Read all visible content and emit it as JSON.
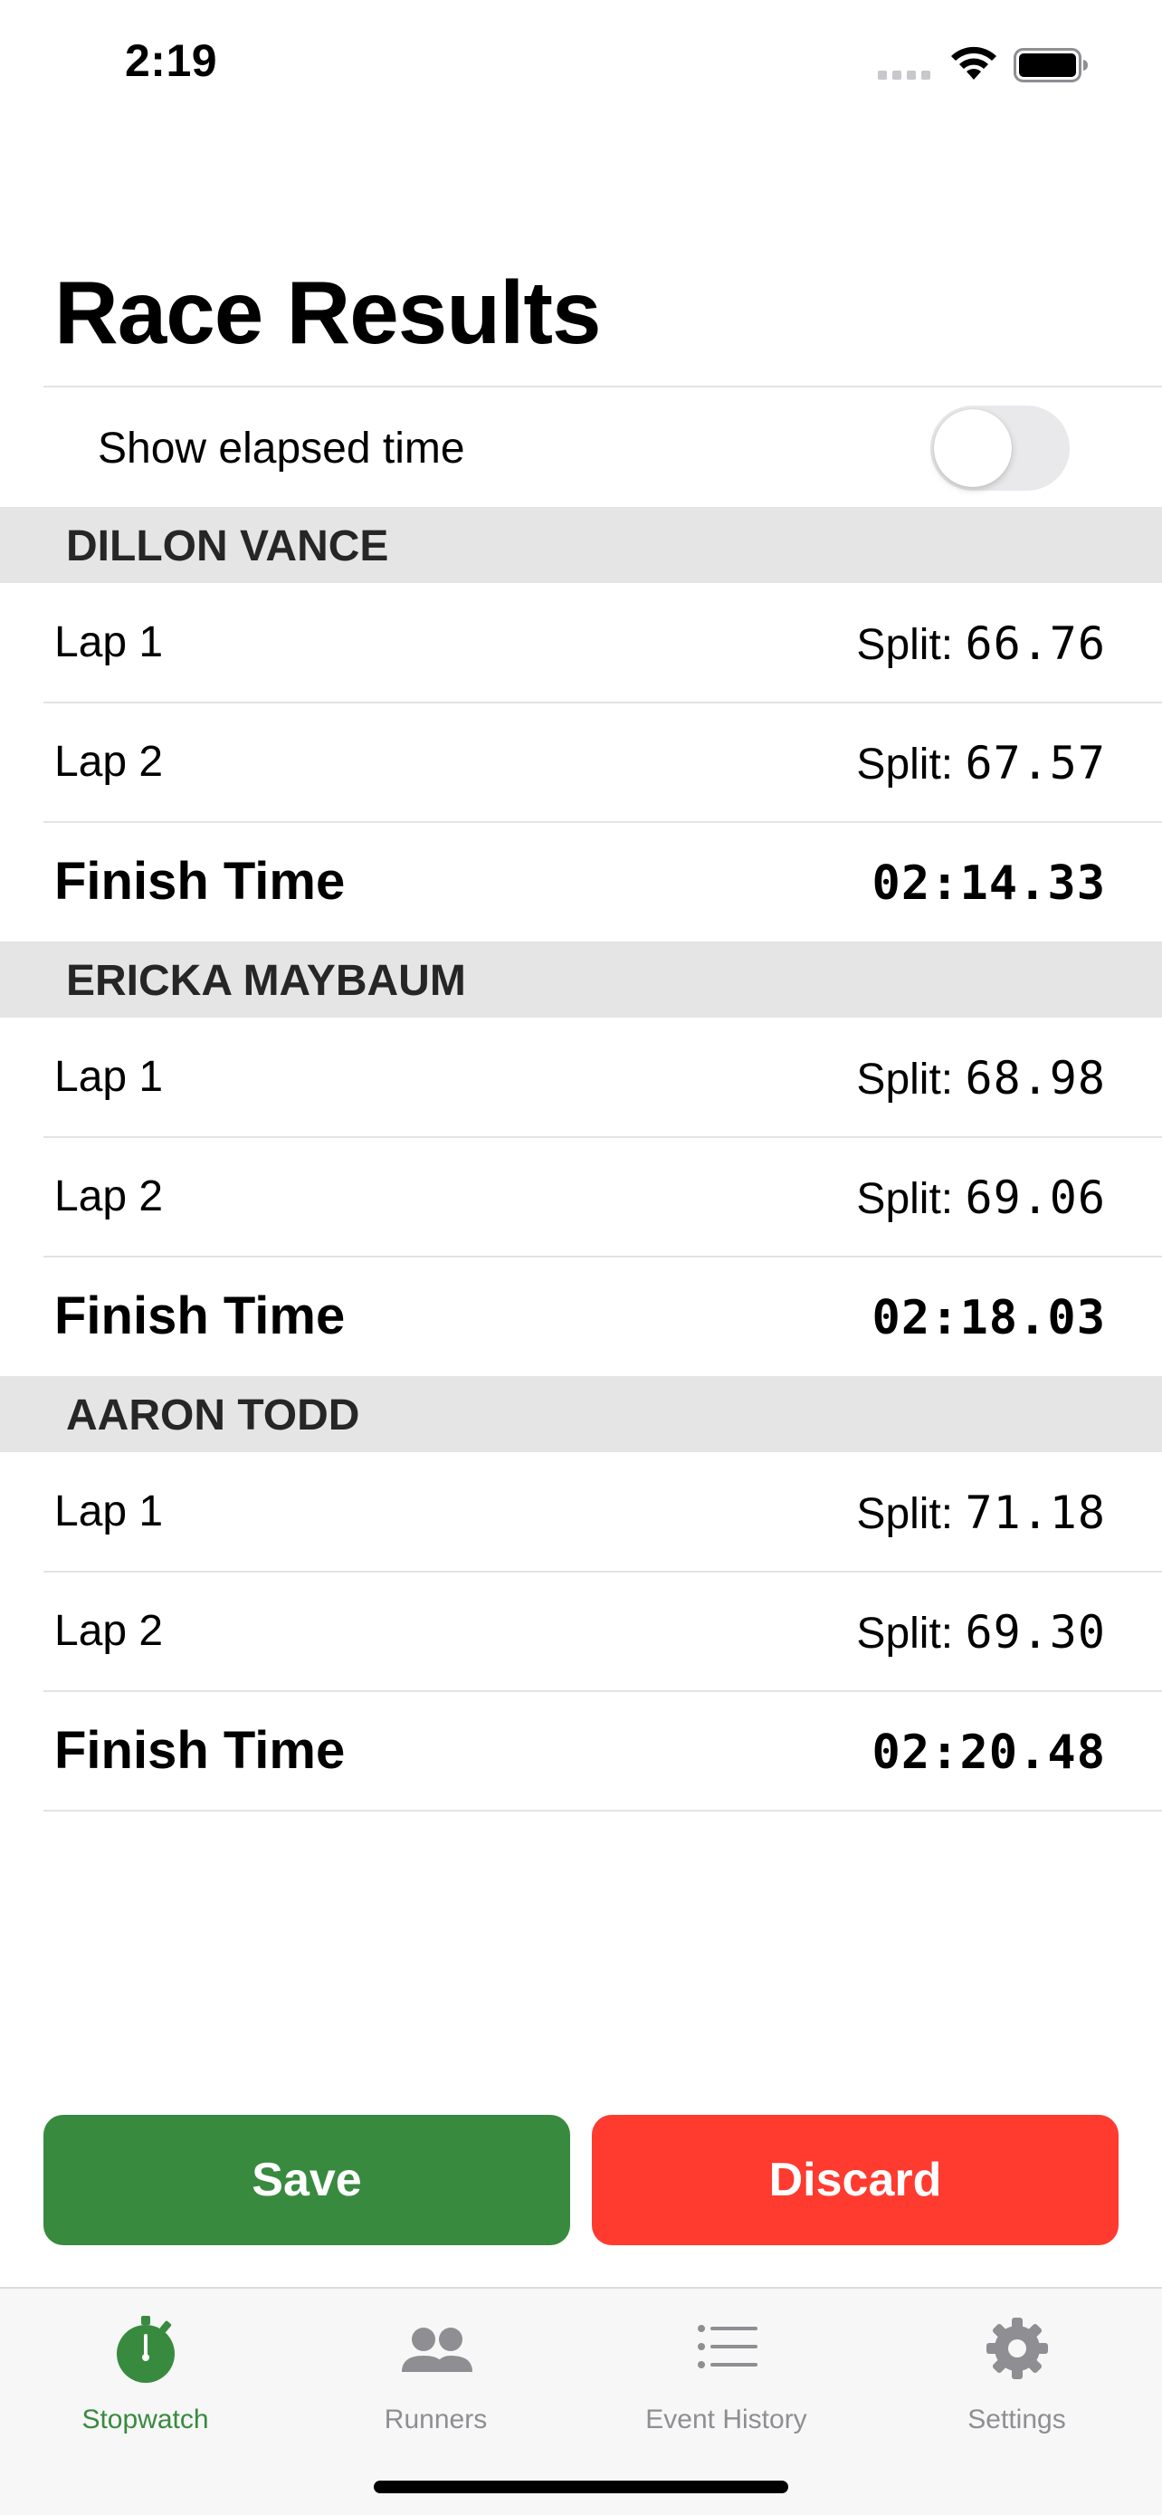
{
  "status_bar": {
    "time": "2:19"
  },
  "title": "Race Results",
  "toggle": {
    "label": "Show elapsed time",
    "on": false
  },
  "runners": [
    {
      "name": "DILLON VANCE",
      "laps": [
        {
          "label": "Lap 1",
          "split_label": "Split:",
          "split": "66.76"
        },
        {
          "label": "Lap 2",
          "split_label": "Split:",
          "split": "67.57"
        }
      ],
      "finish_label": "Finish Time",
      "finish_time": "02:14.33"
    },
    {
      "name": "ERICKA MAYBAUM",
      "laps": [
        {
          "label": "Lap 1",
          "split_label": "Split:",
          "split": "68.98"
        },
        {
          "label": "Lap 2",
          "split_label": "Split:",
          "split": "69.06"
        }
      ],
      "finish_label": "Finish Time",
      "finish_time": "02:18.03"
    },
    {
      "name": "AARON TODD",
      "laps": [
        {
          "label": "Lap 1",
          "split_label": "Split:",
          "split": "71.18"
        },
        {
          "label": "Lap 2",
          "split_label": "Split:",
          "split": "69.30"
        }
      ],
      "finish_label": "Finish Time",
      "finish_time": "02:20.48"
    }
  ],
  "buttons": {
    "save": "Save",
    "discard": "Discard"
  },
  "tabs": [
    {
      "label": "Stopwatch",
      "icon": "stopwatch-icon",
      "active": true
    },
    {
      "label": "Runners",
      "icon": "people-icon",
      "active": false
    },
    {
      "label": "Event History",
      "icon": "list-icon",
      "active": false
    },
    {
      "label": "Settings",
      "icon": "gear-icon",
      "active": false
    }
  ],
  "colors": {
    "accent": "#388a3f",
    "destructive": "#ff3a2f",
    "inactive_tab": "#8e8e93",
    "section_bg": "#e5e5e5"
  }
}
